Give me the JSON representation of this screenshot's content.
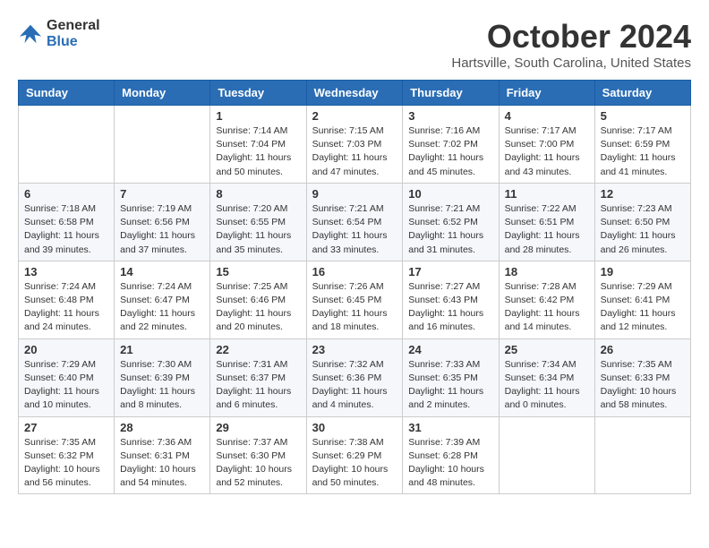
{
  "logo": {
    "general": "General",
    "blue": "Blue"
  },
  "title": "October 2024",
  "location": "Hartsville, South Carolina, United States",
  "days_of_week": [
    "Sunday",
    "Monday",
    "Tuesday",
    "Wednesday",
    "Thursday",
    "Friday",
    "Saturday"
  ],
  "weeks": [
    [
      {
        "day": "",
        "info": ""
      },
      {
        "day": "",
        "info": ""
      },
      {
        "day": "1",
        "info": "Sunrise: 7:14 AM\nSunset: 7:04 PM\nDaylight: 11 hours and 50 minutes."
      },
      {
        "day": "2",
        "info": "Sunrise: 7:15 AM\nSunset: 7:03 PM\nDaylight: 11 hours and 47 minutes."
      },
      {
        "day": "3",
        "info": "Sunrise: 7:16 AM\nSunset: 7:02 PM\nDaylight: 11 hours and 45 minutes."
      },
      {
        "day": "4",
        "info": "Sunrise: 7:17 AM\nSunset: 7:00 PM\nDaylight: 11 hours and 43 minutes."
      },
      {
        "day": "5",
        "info": "Sunrise: 7:17 AM\nSunset: 6:59 PM\nDaylight: 11 hours and 41 minutes."
      }
    ],
    [
      {
        "day": "6",
        "info": "Sunrise: 7:18 AM\nSunset: 6:58 PM\nDaylight: 11 hours and 39 minutes."
      },
      {
        "day": "7",
        "info": "Sunrise: 7:19 AM\nSunset: 6:56 PM\nDaylight: 11 hours and 37 minutes."
      },
      {
        "day": "8",
        "info": "Sunrise: 7:20 AM\nSunset: 6:55 PM\nDaylight: 11 hours and 35 minutes."
      },
      {
        "day": "9",
        "info": "Sunrise: 7:21 AM\nSunset: 6:54 PM\nDaylight: 11 hours and 33 minutes."
      },
      {
        "day": "10",
        "info": "Sunrise: 7:21 AM\nSunset: 6:52 PM\nDaylight: 11 hours and 31 minutes."
      },
      {
        "day": "11",
        "info": "Sunrise: 7:22 AM\nSunset: 6:51 PM\nDaylight: 11 hours and 28 minutes."
      },
      {
        "day": "12",
        "info": "Sunrise: 7:23 AM\nSunset: 6:50 PM\nDaylight: 11 hours and 26 minutes."
      }
    ],
    [
      {
        "day": "13",
        "info": "Sunrise: 7:24 AM\nSunset: 6:48 PM\nDaylight: 11 hours and 24 minutes."
      },
      {
        "day": "14",
        "info": "Sunrise: 7:24 AM\nSunset: 6:47 PM\nDaylight: 11 hours and 22 minutes."
      },
      {
        "day": "15",
        "info": "Sunrise: 7:25 AM\nSunset: 6:46 PM\nDaylight: 11 hours and 20 minutes."
      },
      {
        "day": "16",
        "info": "Sunrise: 7:26 AM\nSunset: 6:45 PM\nDaylight: 11 hours and 18 minutes."
      },
      {
        "day": "17",
        "info": "Sunrise: 7:27 AM\nSunset: 6:43 PM\nDaylight: 11 hours and 16 minutes."
      },
      {
        "day": "18",
        "info": "Sunrise: 7:28 AM\nSunset: 6:42 PM\nDaylight: 11 hours and 14 minutes."
      },
      {
        "day": "19",
        "info": "Sunrise: 7:29 AM\nSunset: 6:41 PM\nDaylight: 11 hours and 12 minutes."
      }
    ],
    [
      {
        "day": "20",
        "info": "Sunrise: 7:29 AM\nSunset: 6:40 PM\nDaylight: 11 hours and 10 minutes."
      },
      {
        "day": "21",
        "info": "Sunrise: 7:30 AM\nSunset: 6:39 PM\nDaylight: 11 hours and 8 minutes."
      },
      {
        "day": "22",
        "info": "Sunrise: 7:31 AM\nSunset: 6:37 PM\nDaylight: 11 hours and 6 minutes."
      },
      {
        "day": "23",
        "info": "Sunrise: 7:32 AM\nSunset: 6:36 PM\nDaylight: 11 hours and 4 minutes."
      },
      {
        "day": "24",
        "info": "Sunrise: 7:33 AM\nSunset: 6:35 PM\nDaylight: 11 hours and 2 minutes."
      },
      {
        "day": "25",
        "info": "Sunrise: 7:34 AM\nSunset: 6:34 PM\nDaylight: 11 hours and 0 minutes."
      },
      {
        "day": "26",
        "info": "Sunrise: 7:35 AM\nSunset: 6:33 PM\nDaylight: 10 hours and 58 minutes."
      }
    ],
    [
      {
        "day": "27",
        "info": "Sunrise: 7:35 AM\nSunset: 6:32 PM\nDaylight: 10 hours and 56 minutes."
      },
      {
        "day": "28",
        "info": "Sunrise: 7:36 AM\nSunset: 6:31 PM\nDaylight: 10 hours and 54 minutes."
      },
      {
        "day": "29",
        "info": "Sunrise: 7:37 AM\nSunset: 6:30 PM\nDaylight: 10 hours and 52 minutes."
      },
      {
        "day": "30",
        "info": "Sunrise: 7:38 AM\nSunset: 6:29 PM\nDaylight: 10 hours and 50 minutes."
      },
      {
        "day": "31",
        "info": "Sunrise: 7:39 AM\nSunset: 6:28 PM\nDaylight: 10 hours and 48 minutes."
      },
      {
        "day": "",
        "info": ""
      },
      {
        "day": "",
        "info": ""
      }
    ]
  ]
}
